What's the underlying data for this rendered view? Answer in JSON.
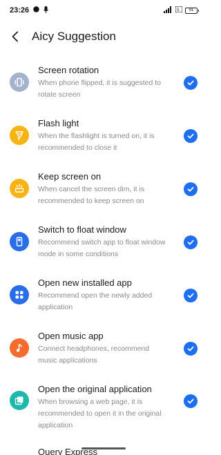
{
  "status_bar": {
    "time": "23:26",
    "battery": "91"
  },
  "header": {
    "title": "Aicy Suggestion"
  },
  "items": [
    {
      "title": "Screen rotation",
      "description": "When phone flipped, it is suggested to rotate screen",
      "icon": "screen-rotation-icon",
      "icon_color": "#a3b2cf",
      "checked": true
    },
    {
      "title": "Flash light",
      "description": "When the flashlight is turned on, it is recommended to close it",
      "icon": "flashlight-icon",
      "icon_color": "#f7b313",
      "checked": true
    },
    {
      "title": "Keep screen on",
      "description": "When cancel the screen dim, it is recommended to keep screen on",
      "icon": "screen-on-icon",
      "icon_color": "#f7b313",
      "checked": true
    },
    {
      "title": "Switch to float window",
      "description": "Recommend switch app to float window mode in some conditions",
      "icon": "float-window-icon",
      "icon_color": "#2a6de8",
      "checked": true
    },
    {
      "title": "Open new installed app",
      "description": "Recommend open the newly added application",
      "icon": "apps-grid-icon",
      "icon_color": "#2a6de8",
      "checked": true
    },
    {
      "title": "Open music app",
      "description": "Connect headphones, recommend music applications",
      "icon": "music-note-icon",
      "icon_color": "#f26d2e",
      "checked": true
    },
    {
      "title": "Open the original application",
      "description": "When browsing a web page, it is recommended to open it in the original application",
      "icon": "open-app-icon",
      "icon_color": "#1fb8ad",
      "checked": true
    },
    {
      "title": "Query Express",
      "description": "",
      "icon": "",
      "icon_color": "",
      "checked": true
    }
  ],
  "colors": {
    "accent": "#1e6ff0"
  }
}
